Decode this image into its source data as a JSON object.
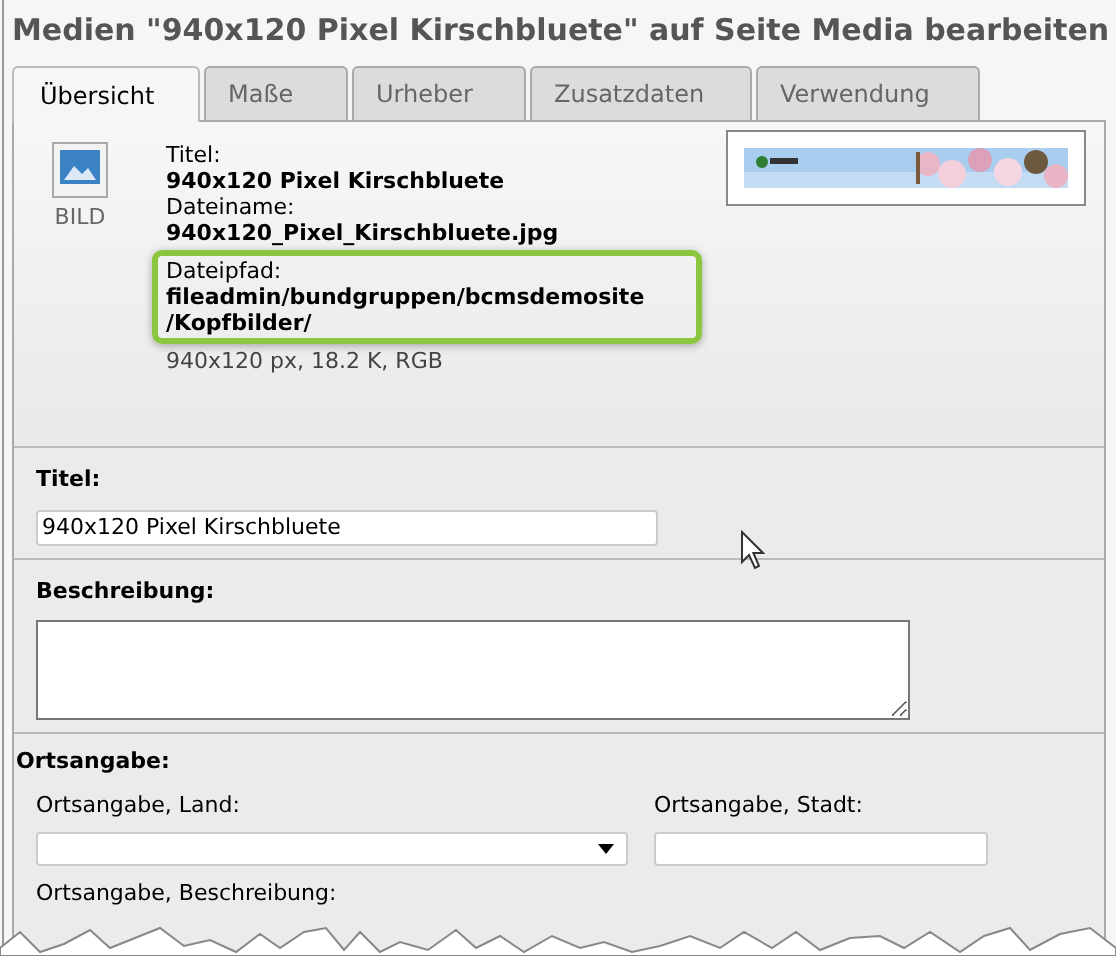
{
  "window": {
    "title": "Medien \"940x120 Pixel Kirschbluete\" auf Seite Media bearbeiten"
  },
  "tabs": [
    {
      "label": "Übersicht",
      "selected": true
    },
    {
      "label": "Maße",
      "selected": false
    },
    {
      "label": "Urheber",
      "selected": false
    },
    {
      "label": "Zusatzdaten",
      "selected": false
    },
    {
      "label": "Verwendung",
      "selected": false
    }
  ],
  "file_info": {
    "type_label": "BILD",
    "title_label": "Titel:",
    "title": "940x120 Pixel Kirschbluete",
    "filename_label": "Dateiname:",
    "filename": "940x120_Pixel_Kirschbluete.jpg",
    "path_label": "Dateipfad:",
    "path_lines": [
      "fileadmin/bundgruppen/bcmsdemosite",
      "/Kopfbilder/"
    ],
    "details": "940x120 px, 18.2 K, RGB"
  },
  "fields": [
    {
      "kind": "text",
      "label": "Titel:",
      "value": "940x120 Pixel Kirschbluete"
    },
    {
      "kind": "textarea",
      "label": "Beschreibung:"
    }
  ],
  "location": {
    "label": "Ortsangabe:",
    "country_label": "Ortsangabe, Land:",
    "city_label": "Ortsangabe, Stadt:",
    "description_label": "Ortsangabe, Beschreibung:"
  }
}
